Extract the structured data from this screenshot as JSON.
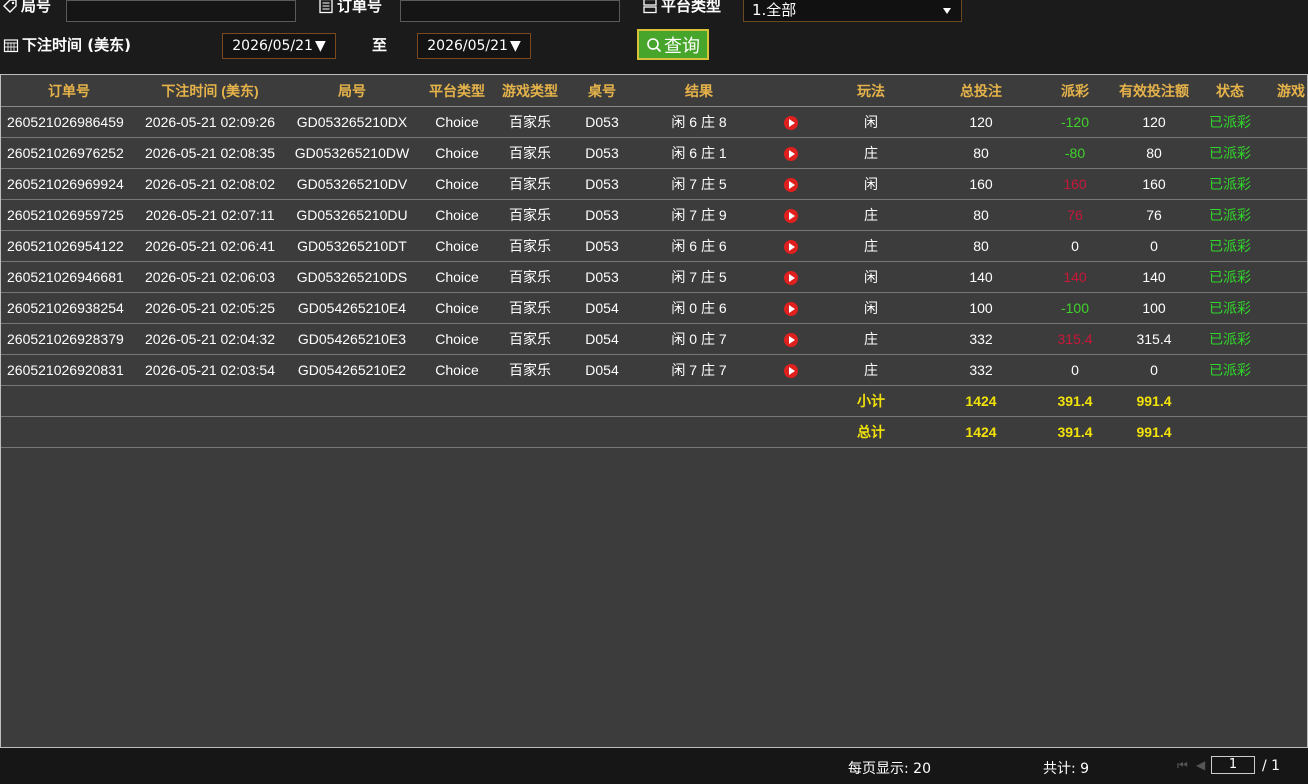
{
  "filters": {
    "round_label": "局号",
    "order_label": "订单号",
    "platform_label": "平台类型",
    "platform_value": "1.全部",
    "bet_time_label": "下注时间 (美东)",
    "date_from": "2026/05/21",
    "to_label": "至",
    "date_to": "2026/05/21",
    "query_label": "查询"
  },
  "table": {
    "headers": [
      "订单号",
      "下注时间 (美东)",
      "局号",
      "平台类型",
      "游戏类型",
      "桌号",
      "结果",
      "",
      "玩法",
      "总投注",
      "派彩",
      "有效投注额",
      "状态",
      "游戏"
    ],
    "rows": [
      {
        "order": "260521026986459",
        "time": "2026-05-21 02:09:26",
        "round": "GD053265210DX",
        "platform": "Choice",
        "game": "百家乐",
        "table": "D053",
        "result": "闲 6 庄 8",
        "play": "闲",
        "bet": "120",
        "payout": "-120",
        "payout_sign": "neg",
        "valid": "120",
        "status": "已派彩"
      },
      {
        "order": "260521026976252",
        "time": "2026-05-21 02:08:35",
        "round": "GD053265210DW",
        "platform": "Choice",
        "game": "百家乐",
        "table": "D053",
        "result": "闲 6 庄 1",
        "play": "庄",
        "bet": "80",
        "payout": "-80",
        "payout_sign": "neg",
        "valid": "80",
        "status": "已派彩"
      },
      {
        "order": "260521026969924",
        "time": "2026-05-21 02:08:02",
        "round": "GD053265210DV",
        "platform": "Choice",
        "game": "百家乐",
        "table": "D053",
        "result": "闲 7 庄 5",
        "play": "闲",
        "bet": "160",
        "payout": "160",
        "payout_sign": "pos",
        "valid": "160",
        "status": "已派彩"
      },
      {
        "order": "260521026959725",
        "time": "2026-05-21 02:07:11",
        "round": "GD053265210DU",
        "platform": "Choice",
        "game": "百家乐",
        "table": "D053",
        "result": "闲 7 庄 9",
        "play": "庄",
        "bet": "80",
        "payout": "76",
        "payout_sign": "pos",
        "valid": "76",
        "status": "已派彩"
      },
      {
        "order": "260521026954122",
        "time": "2026-05-21 02:06:41",
        "round": "GD053265210DT",
        "platform": "Choice",
        "game": "百家乐",
        "table": "D053",
        "result": "闲 6 庄 6",
        "play": "庄",
        "bet": "80",
        "payout": "0",
        "payout_sign": "zero",
        "valid": "0",
        "status": "已派彩"
      },
      {
        "order": "260521026946681",
        "time": "2026-05-21 02:06:03",
        "round": "GD053265210DS",
        "platform": "Choice",
        "game": "百家乐",
        "table": "D053",
        "result": "闲 7 庄 5",
        "play": "闲",
        "bet": "140",
        "payout": "140",
        "payout_sign": "pos",
        "valid": "140",
        "status": "已派彩"
      },
      {
        "order": "260521026938254",
        "time": "2026-05-21 02:05:25",
        "round": "GD054265210E4",
        "platform": "Choice",
        "game": "百家乐",
        "table": "D054",
        "result": "闲 0 庄 6",
        "play": "闲",
        "bet": "100",
        "payout": "-100",
        "payout_sign": "neg",
        "valid": "100",
        "status": "已派彩"
      },
      {
        "order": "260521026928379",
        "time": "2026-05-21 02:04:32",
        "round": "GD054265210E3",
        "platform": "Choice",
        "game": "百家乐",
        "table": "D054",
        "result": "闲 0 庄 7",
        "play": "庄",
        "bet": "332",
        "payout": "315.4",
        "payout_sign": "pos",
        "valid": "315.4",
        "status": "已派彩"
      },
      {
        "order": "260521026920831",
        "time": "2026-05-21 02:03:54",
        "round": "GD054265210E2",
        "platform": "Choice",
        "game": "百家乐",
        "table": "D054",
        "result": "闲 7 庄 7",
        "play": "庄",
        "bet": "332",
        "payout": "0",
        "payout_sign": "zero",
        "valid": "0",
        "status": "已派彩"
      }
    ],
    "subtotal": {
      "label": "小计",
      "bet": "1424",
      "payout": "391.4",
      "valid": "991.4"
    },
    "total": {
      "label": "总计",
      "bet": "1424",
      "payout": "391.4",
      "valid": "991.4"
    }
  },
  "footer": {
    "per_page": "每页显示: 20",
    "total_count": "共计: 9",
    "page_input": "1",
    "page_total": "/ 1"
  },
  "colors": {
    "accent": "#e6b34a",
    "query_button": "#46a52a",
    "payout_negative": "#3fd22a",
    "payout_positive": "#c8183a",
    "status": "#31d62a",
    "summary": "#f2e20a"
  }
}
